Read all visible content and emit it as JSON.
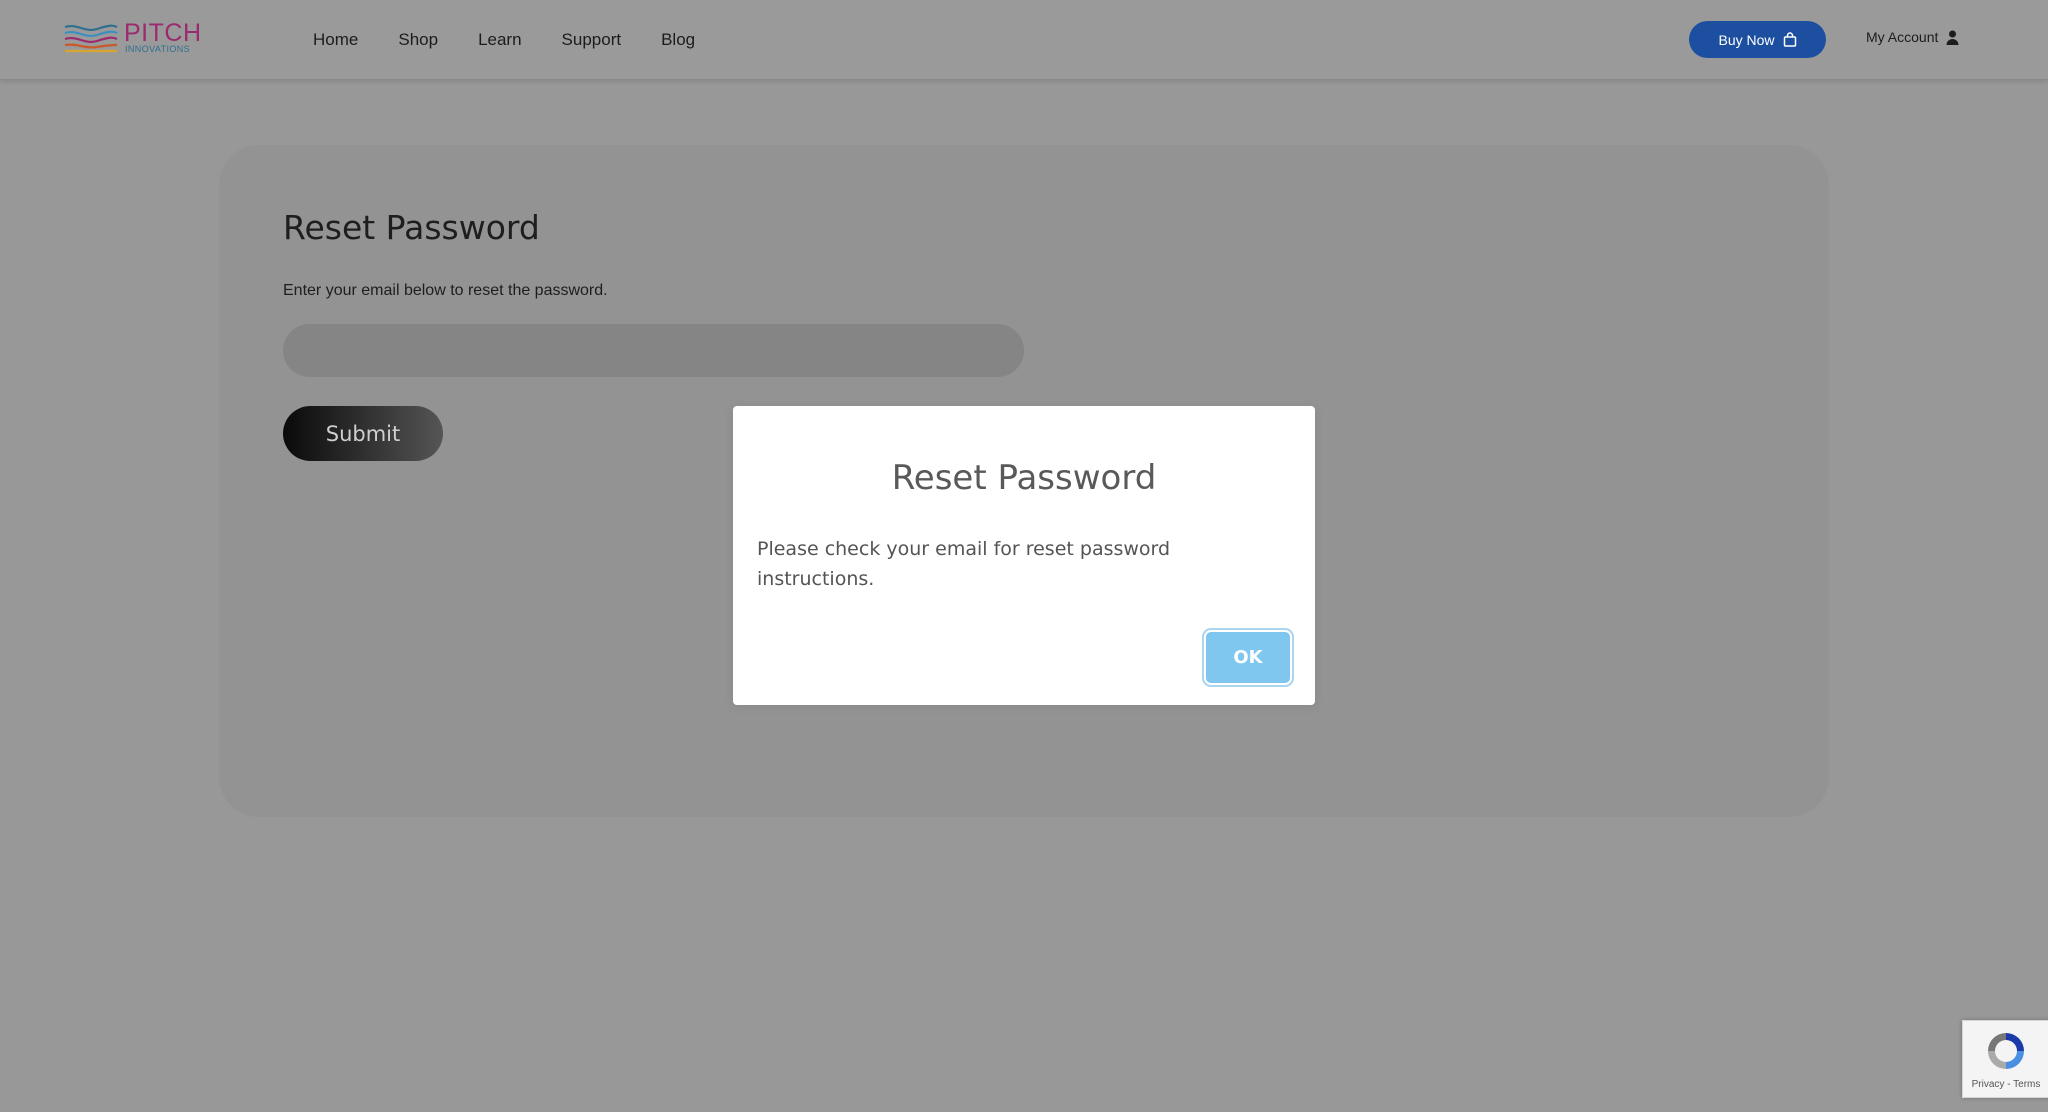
{
  "header": {
    "logo": {
      "title": "PITCH",
      "subtitle": "INNOVATIONS"
    },
    "nav": [
      {
        "label": "Home"
      },
      {
        "label": "Shop"
      },
      {
        "label": "Learn"
      },
      {
        "label": "Support"
      },
      {
        "label": "Blog"
      }
    ],
    "buy_now_label": "Buy Now",
    "account_label": "My Account",
    "colors": {
      "buy_button": "#1d4fa0",
      "logo_text": "#9b2a6e"
    }
  },
  "form": {
    "title": "Reset Password",
    "instructions": "Enter your email below to reset the password.",
    "email_value": "",
    "submit_label": "Submit"
  },
  "modal": {
    "title": "Reset Password",
    "message": "Please check your email for reset password instructions.",
    "ok_label": "OK",
    "ok_color": "#7fc7ee"
  },
  "recaptcha": {
    "links": "Privacy - Terms"
  }
}
